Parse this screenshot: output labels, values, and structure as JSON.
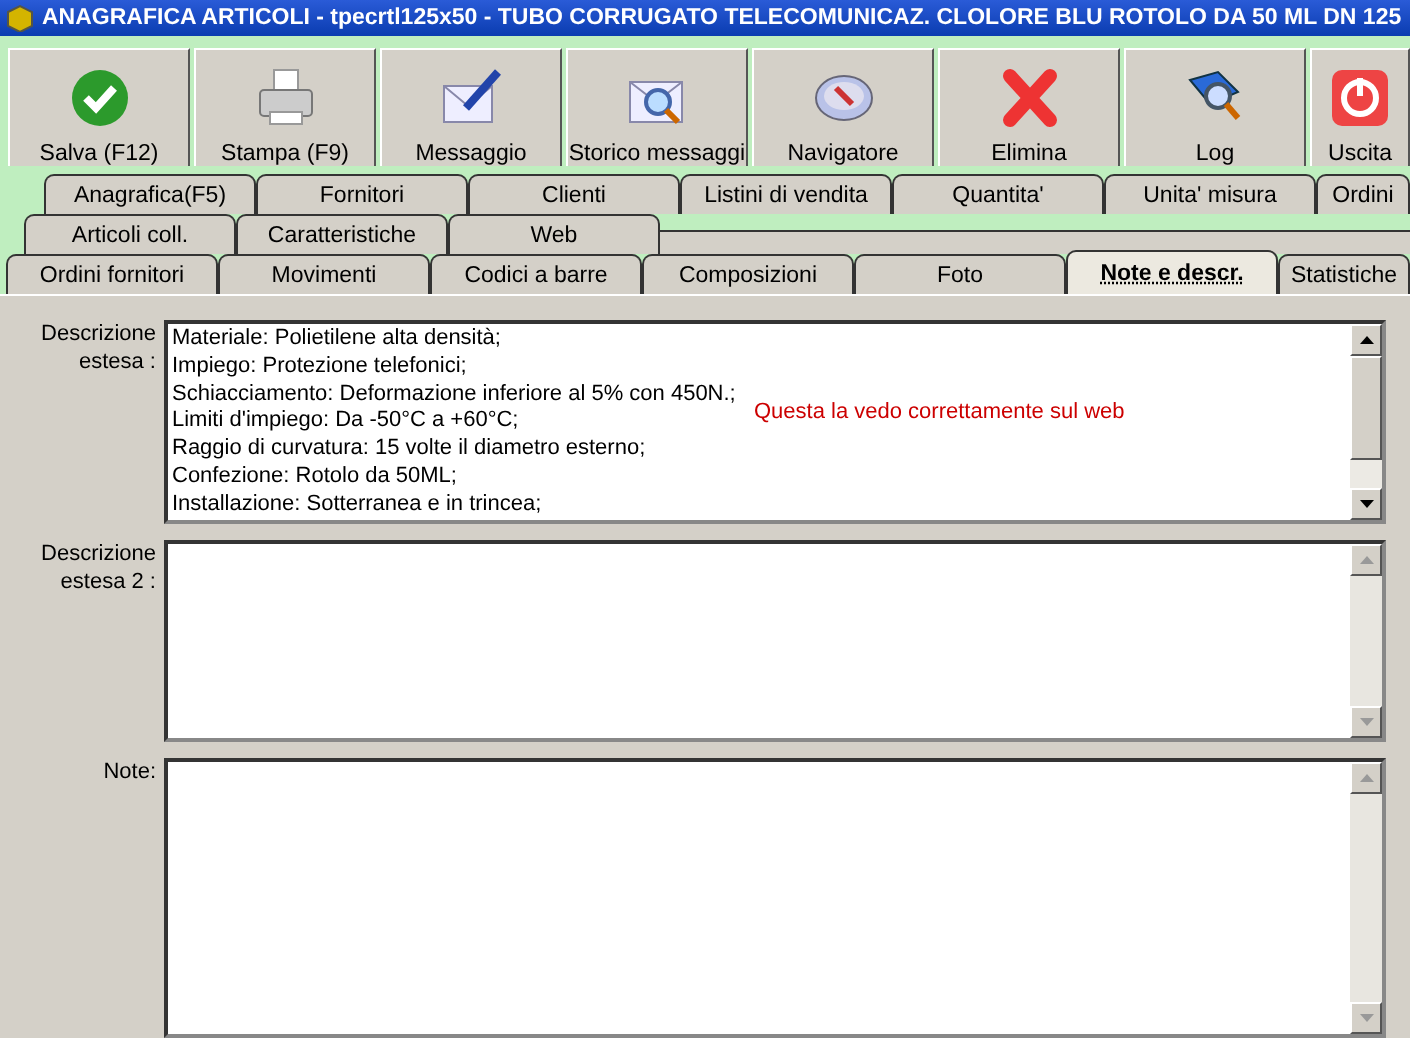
{
  "window": {
    "title": "ANAGRAFICA ARTICOLI - tpecrtl125x50 - TUBO CORRUGATO TELECOMUNICAZ. CLOLORE BLU ROTOLO DA 50 ML DN 125"
  },
  "toolbar": [
    {
      "kind": "save",
      "label": "Salva (F12)"
    },
    {
      "kind": "print",
      "label": "Stampa (F9)"
    },
    {
      "kind": "message",
      "label": "Messaggio"
    },
    {
      "kind": "history",
      "label": "Storico messaggi"
    },
    {
      "kind": "compass",
      "label": "Navigatore"
    },
    {
      "kind": "delete",
      "label": "Elimina"
    },
    {
      "kind": "log",
      "label": "Log"
    },
    {
      "kind": "exit",
      "label": "Uscita"
    }
  ],
  "tab_rows": [
    [
      {
        "label": "Anagrafica(F5)",
        "selected": false
      },
      {
        "label": "Fornitori",
        "selected": false
      },
      {
        "label": "Clienti",
        "selected": false
      },
      {
        "label": "Listini di vendita",
        "selected": false
      },
      {
        "label": "Quantita'",
        "selected": false
      },
      {
        "label": "Unita' misura",
        "selected": false
      },
      {
        "label": "Ordini",
        "selected": false
      }
    ],
    [
      {
        "label": "Articoli coll.",
        "selected": false
      },
      {
        "label": "Caratteristiche",
        "selected": false
      },
      {
        "label": "Web",
        "selected": false
      }
    ],
    [
      {
        "label": "Ordini fornitori",
        "selected": false
      },
      {
        "label": "Movimenti",
        "selected": false
      },
      {
        "label": "Codici a barre",
        "selected": false
      },
      {
        "label": "Composizioni",
        "selected": false
      },
      {
        "label": "Foto",
        "selected": false
      },
      {
        "label": "Note e descr.",
        "selected": true
      },
      {
        "label": "Statistiche",
        "selected": false
      }
    ]
  ],
  "fields": [
    {
      "label": "Descrizione estesa :",
      "lines": [
        "Materiale: Polietilene alta densità;",
        "Impiego: Protezione telefonici;",
        "Schiacciamento: Deformazione inferiore al 5% con 450N.;",
        "Limiti d'impiego: Da -50°C a +60°C;",
        "Raggio di curvatura: 15 volte il diametro esterno;",
        "Confezione: Rotolo da 50ML;",
        "Installazione: Sotterranea e in trincea;"
      ],
      "note": "Questa la vedo correttamente sul web",
      "disabled": false
    },
    {
      "label": "Descrizione estesa 2 :",
      "disabled": true
    },
    {
      "label": "Note:",
      "disabled": true
    }
  ]
}
